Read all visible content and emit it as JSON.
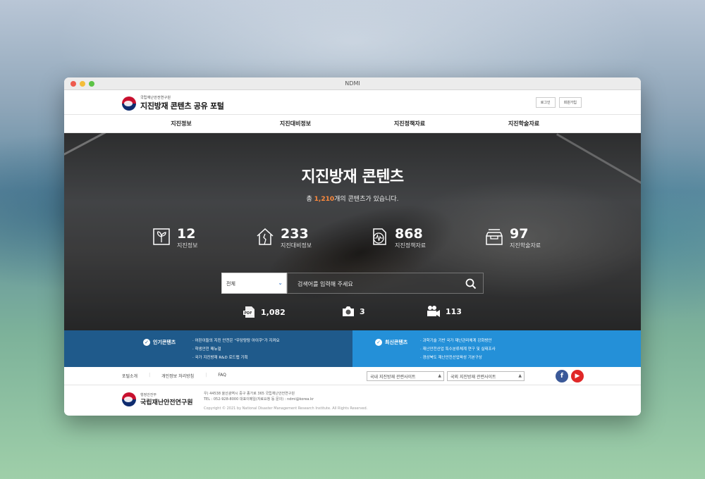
{
  "window": {
    "title": "NDMI"
  },
  "header": {
    "org_small": "국립재난안전연구원",
    "site_title": "지진방재 콘텐츠 공유 포털",
    "login_label": "로그인",
    "signup_label": "회원가입"
  },
  "nav": {
    "items": [
      "지진정보",
      "지진대비정보",
      "지진정책자료",
      "지진학술자료"
    ]
  },
  "hero": {
    "title": "지진방재 콘텐츠",
    "sub_prefix": "총",
    "total_count": "1,210",
    "sub_suffix": "개의 콘텐츠가 있습니다.",
    "stats": [
      {
        "value": "12",
        "label": "지진정보",
        "icon": "plant-icon"
      },
      {
        "value": "233",
        "label": "지진대비정보",
        "icon": "cracked-house-icon"
      },
      {
        "value": "868",
        "label": "지진정책자료",
        "icon": "seismograph-document-icon"
      },
      {
        "value": "97",
        "label": "지진학술자료",
        "icon": "archive-tray-icon"
      }
    ],
    "search": {
      "category": "전체",
      "placeholder": "검색어를 입력해 주세요"
    },
    "media": [
      {
        "value": "1,082",
        "icon": "pdf-icon"
      },
      {
        "value": "3",
        "icon": "camera-icon"
      },
      {
        "value": "113",
        "icon": "video-camera-icon"
      }
    ]
  },
  "popular": {
    "title": "인기콘텐츠",
    "items": [
      "어린이들의 지진 안전은 \"우당탕탕 아이쿠\"가 지켜요",
      "학생안전 매뉴얼",
      "국가 지진방재 R&D 로드맵 기획"
    ]
  },
  "latest": {
    "title": "최신콘텐츠",
    "items": [
      "과학기술 기반 국가 재난관리체계 강화방안",
      "재난안전산업 특수분류체계 연구 및 실태조사",
      "경상북도 재난안전산업육성 기본구상"
    ]
  },
  "footer_links": {
    "links": [
      "포털소개",
      "개인정보 처리방침",
      "FAQ"
    ],
    "domestic_select": "국내 지진방재 관련사이트",
    "overseas_select": "국외 지진방재 관련사이트"
  },
  "footer": {
    "org_small": "행정안전부",
    "org_name": "국립재난안전연구원",
    "address": "우) 44538 울산광역시 중구 종가로 365 국립재난안전연구원",
    "contact": "TEL : 052-928-8000    대표이메일(자료요청 등 문의) : ndmi@korea.kr",
    "copyright": "Copyright © 2021 by National Disaster Management Research Institute. All Rights Reserved."
  },
  "colors": {
    "accent_orange": "#ff8a3d",
    "popular_bg": "#1f5a8b",
    "latest_bg": "#2490d8",
    "facebook": "#3b5998",
    "youtube": "#e02828"
  }
}
